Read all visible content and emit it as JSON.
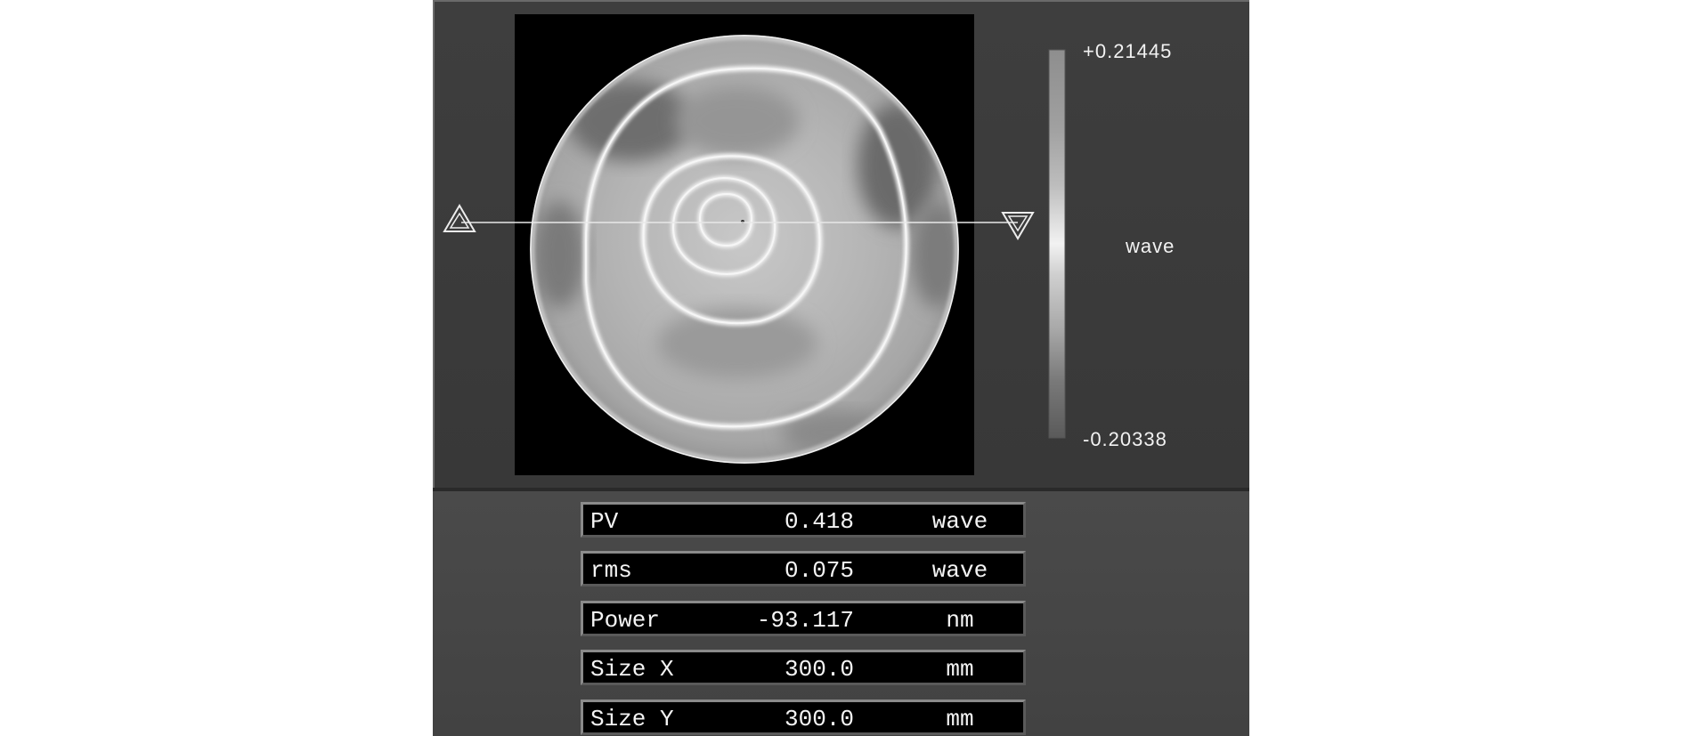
{
  "colorbar": {
    "max_label": "+0.21445",
    "min_label": "-0.20338",
    "unit_label": "wave",
    "max": 0.21445,
    "min": -0.20338
  },
  "map": {
    "background_color": "#000000",
    "ring_color": "#f4f4f4",
    "fill_color": "#bdbdbd",
    "profile_line_color": "#e8e8e8"
  },
  "stats": {
    "rows": [
      {
        "name": "PV",
        "value": "0.418",
        "unit": "wave"
      },
      {
        "name": "rms",
        "value": "0.075",
        "unit": "wave"
      },
      {
        "name": "Power",
        "value": "-93.117",
        "unit": "nm"
      },
      {
        "name": "Size X",
        "value": "300.0",
        "unit": "mm"
      },
      {
        "name": "Size Y",
        "value": "300.0",
        "unit": "mm"
      }
    ]
  }
}
